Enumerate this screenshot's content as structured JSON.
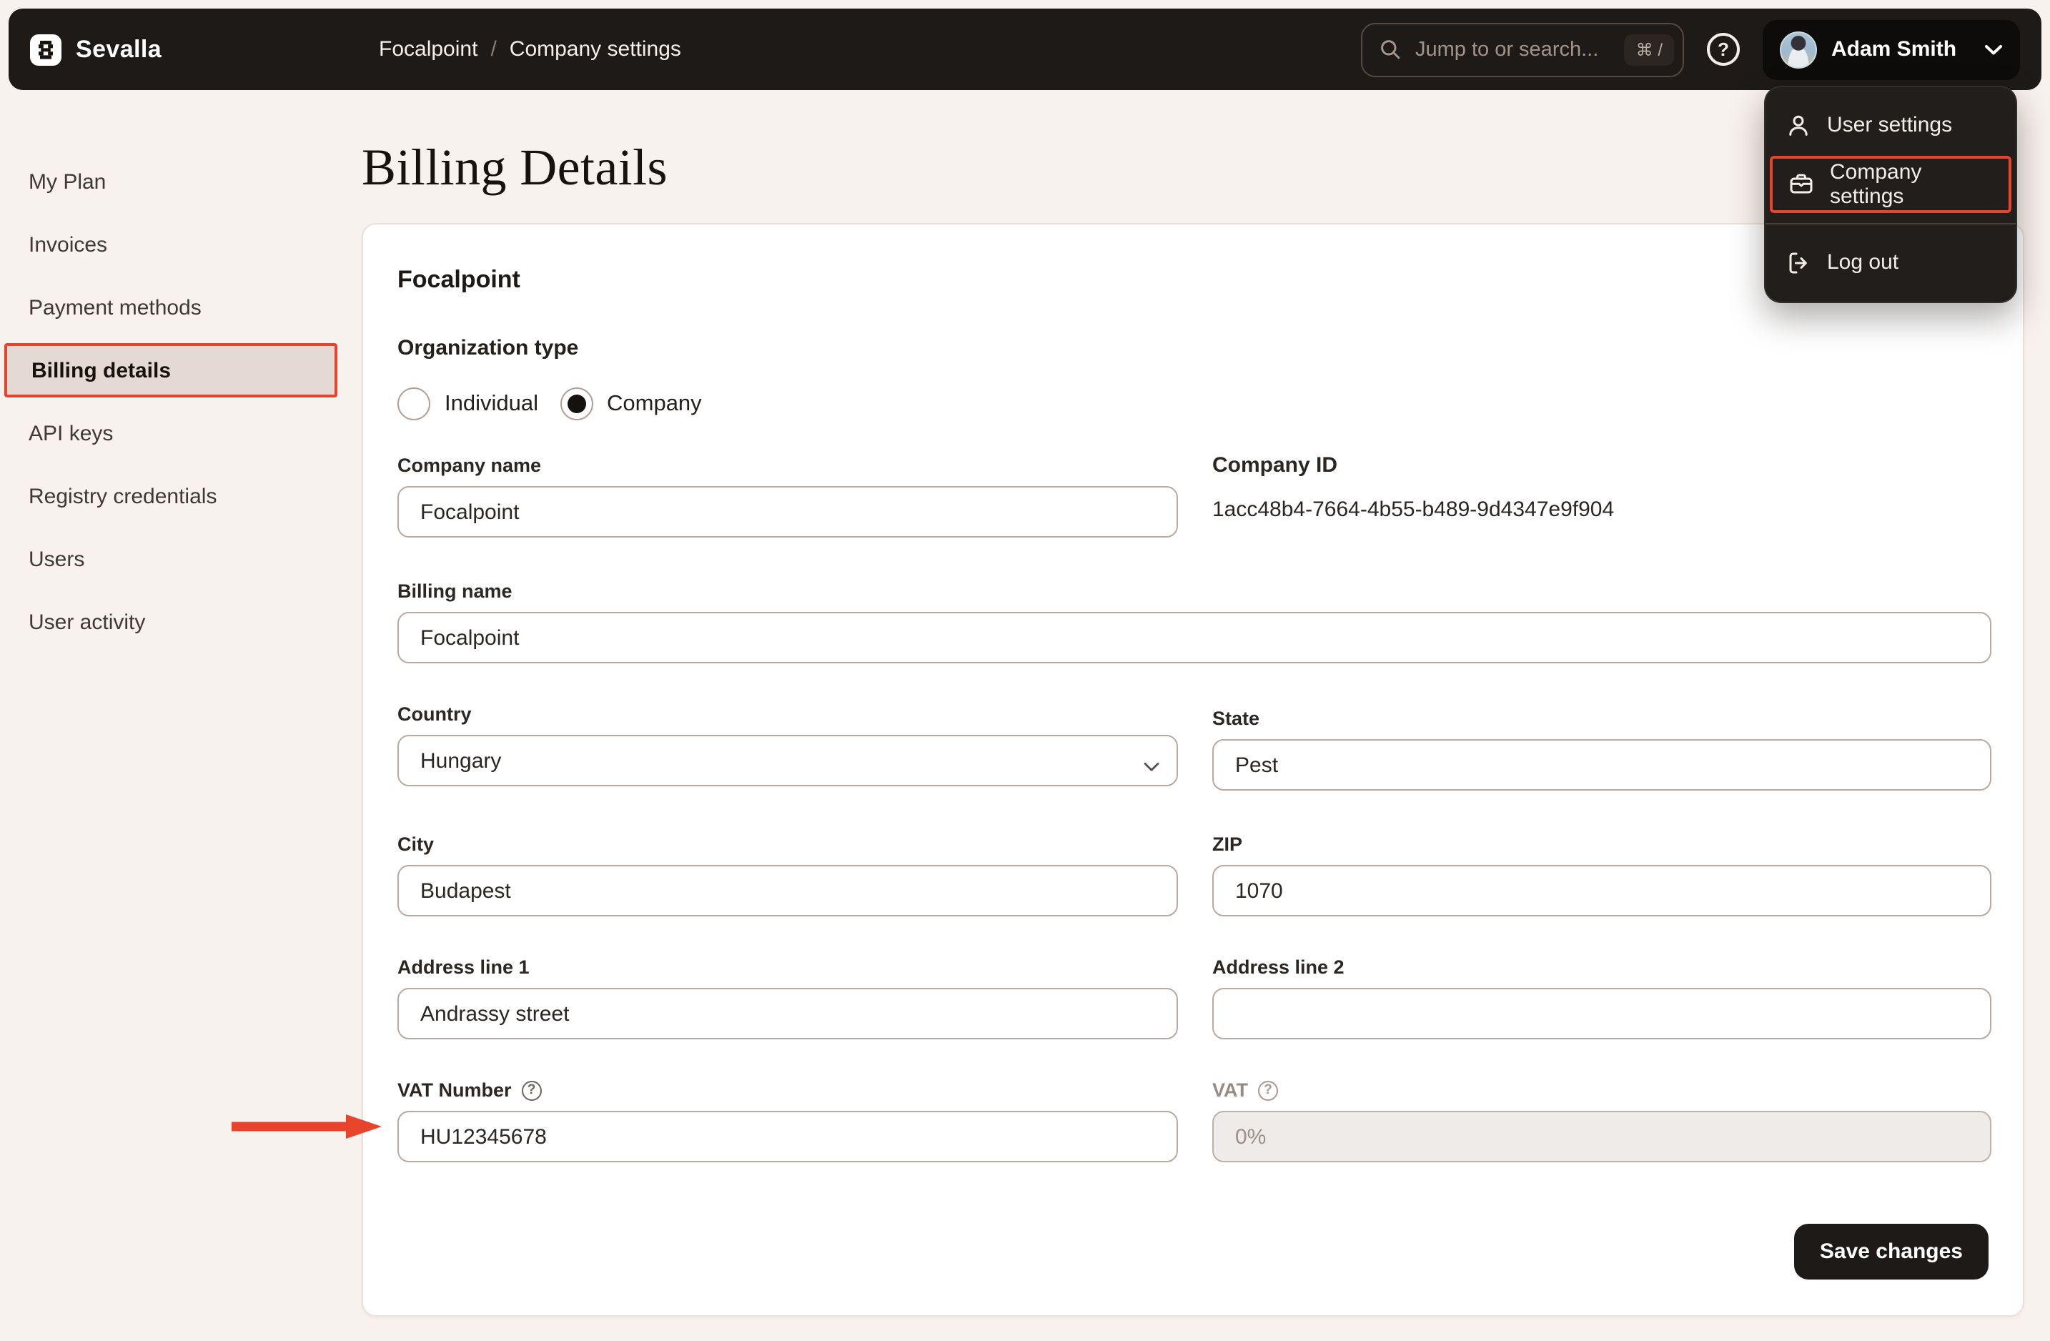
{
  "header": {
    "brand": "Sevalla",
    "breadcrumb": {
      "org": "Focalpoint",
      "separator": "/",
      "page": "Company settings"
    },
    "search": {
      "placeholder": "Jump to or search...",
      "shortcut": "⌘ /"
    },
    "help_label": "?",
    "user": {
      "name": "Adam Smith"
    }
  },
  "user_menu": {
    "items": [
      {
        "label": "User settings",
        "icon": "user-icon",
        "highlighted": false
      },
      {
        "label": "Company settings",
        "icon": "briefcase-icon",
        "highlighted": true
      },
      {
        "label": "Log out",
        "icon": "logout-icon",
        "highlighted": false
      }
    ]
  },
  "sidebar": {
    "items": [
      {
        "label": "My Plan",
        "active": false
      },
      {
        "label": "Invoices",
        "active": false
      },
      {
        "label": "Payment methods",
        "active": false
      },
      {
        "label": "Billing details",
        "active": true,
        "highlighted": true
      },
      {
        "label": "API keys",
        "active": false
      },
      {
        "label": "Registry credentials",
        "active": false
      },
      {
        "label": "Users",
        "active": false
      },
      {
        "label": "User activity",
        "active": false
      }
    ]
  },
  "page": {
    "title": "Billing Details"
  },
  "form": {
    "card_title": "Focalpoint",
    "organization_type": {
      "label": "Organization type",
      "options": [
        {
          "label": "Individual",
          "selected": false
        },
        {
          "label": "Company",
          "selected": true
        }
      ]
    },
    "fields": {
      "company_name": {
        "label": "Company name",
        "value": "Focalpoint"
      },
      "company_id": {
        "label": "Company ID",
        "value": "1acc48b4-7664-4b55-b489-9d4347e9f904"
      },
      "billing_name": {
        "label": "Billing name",
        "value": "Focalpoint"
      },
      "country": {
        "label": "Country",
        "value": "Hungary"
      },
      "state": {
        "label": "State",
        "value": "Pest"
      },
      "city": {
        "label": "City",
        "value": "Budapest"
      },
      "zip": {
        "label": "ZIP",
        "value": "1070"
      },
      "address1": {
        "label": "Address line 1",
        "value": "Andrassy street"
      },
      "address2": {
        "label": "Address line 2",
        "value": ""
      },
      "vat_number": {
        "label": "VAT Number",
        "value": "HU12345678",
        "has_tooltip": true
      },
      "vat": {
        "label": "VAT",
        "value": "0%",
        "disabled": true,
        "has_tooltip": true
      }
    },
    "save_label": "Save changes"
  },
  "colors": {
    "page_bg": "#f8f2ee",
    "header_bg": "#1d1a17",
    "menu_bg": "#211e1b",
    "card_bg": "#ffffff",
    "active_item_bg": "#e4dad3",
    "input_border": "#b9aaa1",
    "annotation_red": "#e8432b",
    "save_button_bg": "#1d1a17"
  }
}
